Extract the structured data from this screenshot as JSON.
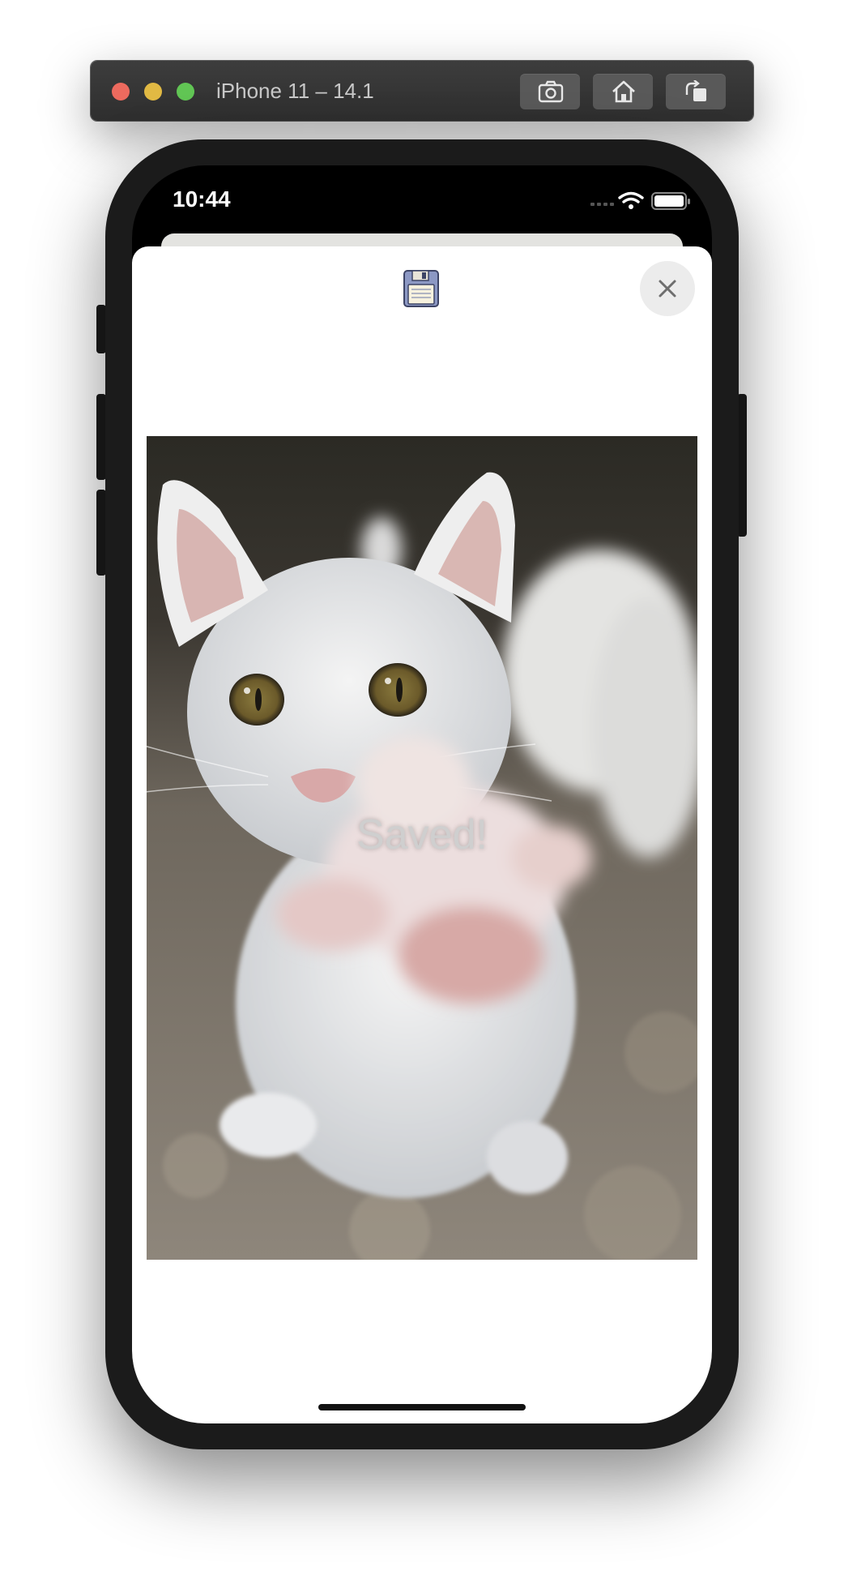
{
  "simulator": {
    "title": "iPhone 11 – 14.1",
    "buttons": [
      "screenshot-icon",
      "home-icon",
      "rotate-icon"
    ]
  },
  "status_bar": {
    "time": "10:44",
    "icons": [
      "cellular-signal-icon",
      "wifi-icon",
      "battery-icon"
    ]
  },
  "sheet": {
    "top_icon": "save-icon",
    "close_icon": "close-icon",
    "photo": {
      "subject": "white-kitten-reaching-paw",
      "overlay_text": "Saved!"
    }
  },
  "colors": {
    "titlebar": "#333333",
    "phone_frame": "#1b1b1b",
    "sheet_background": "#ffffff",
    "close_button_bg": "#ececec",
    "overlay_text": "#cfcfcf"
  }
}
